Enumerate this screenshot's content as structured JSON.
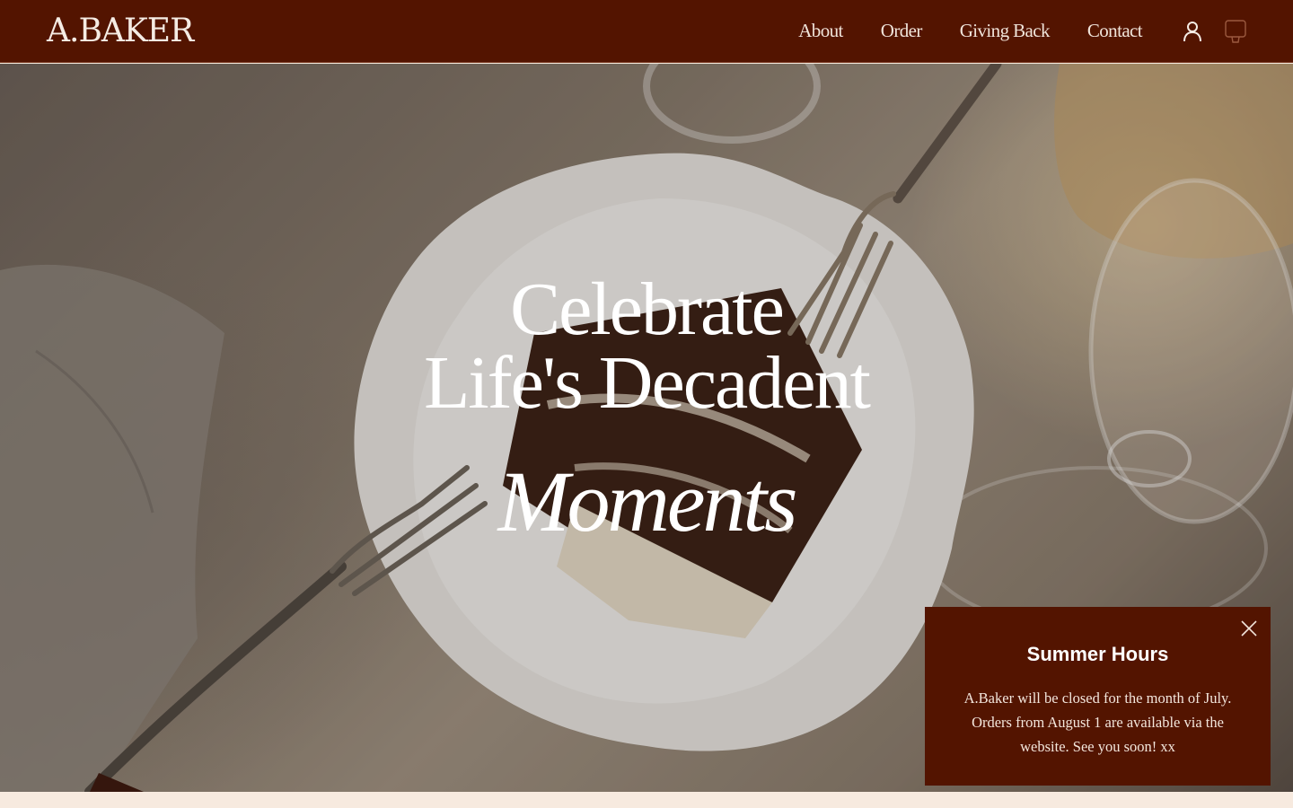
{
  "header": {
    "logo": "A.BAKER",
    "nav": [
      "About",
      "Order",
      "Giving Back",
      "Contact"
    ],
    "account_icon": "user-icon",
    "cart_icon": "shopping-bag-icon"
  },
  "hero": {
    "line1": "Celebrate",
    "line2": "Life's Decadent",
    "script": "Moments"
  },
  "popup": {
    "title": "Summer Hours",
    "body": "A.Baker will be closed for the month of July. Orders from August 1 are available via the website. See you soon! xx",
    "close_icon": "close-icon"
  },
  "colors": {
    "brand": "#531400",
    "cream": "#f5e9dc",
    "text_light": "#f0e4da"
  }
}
